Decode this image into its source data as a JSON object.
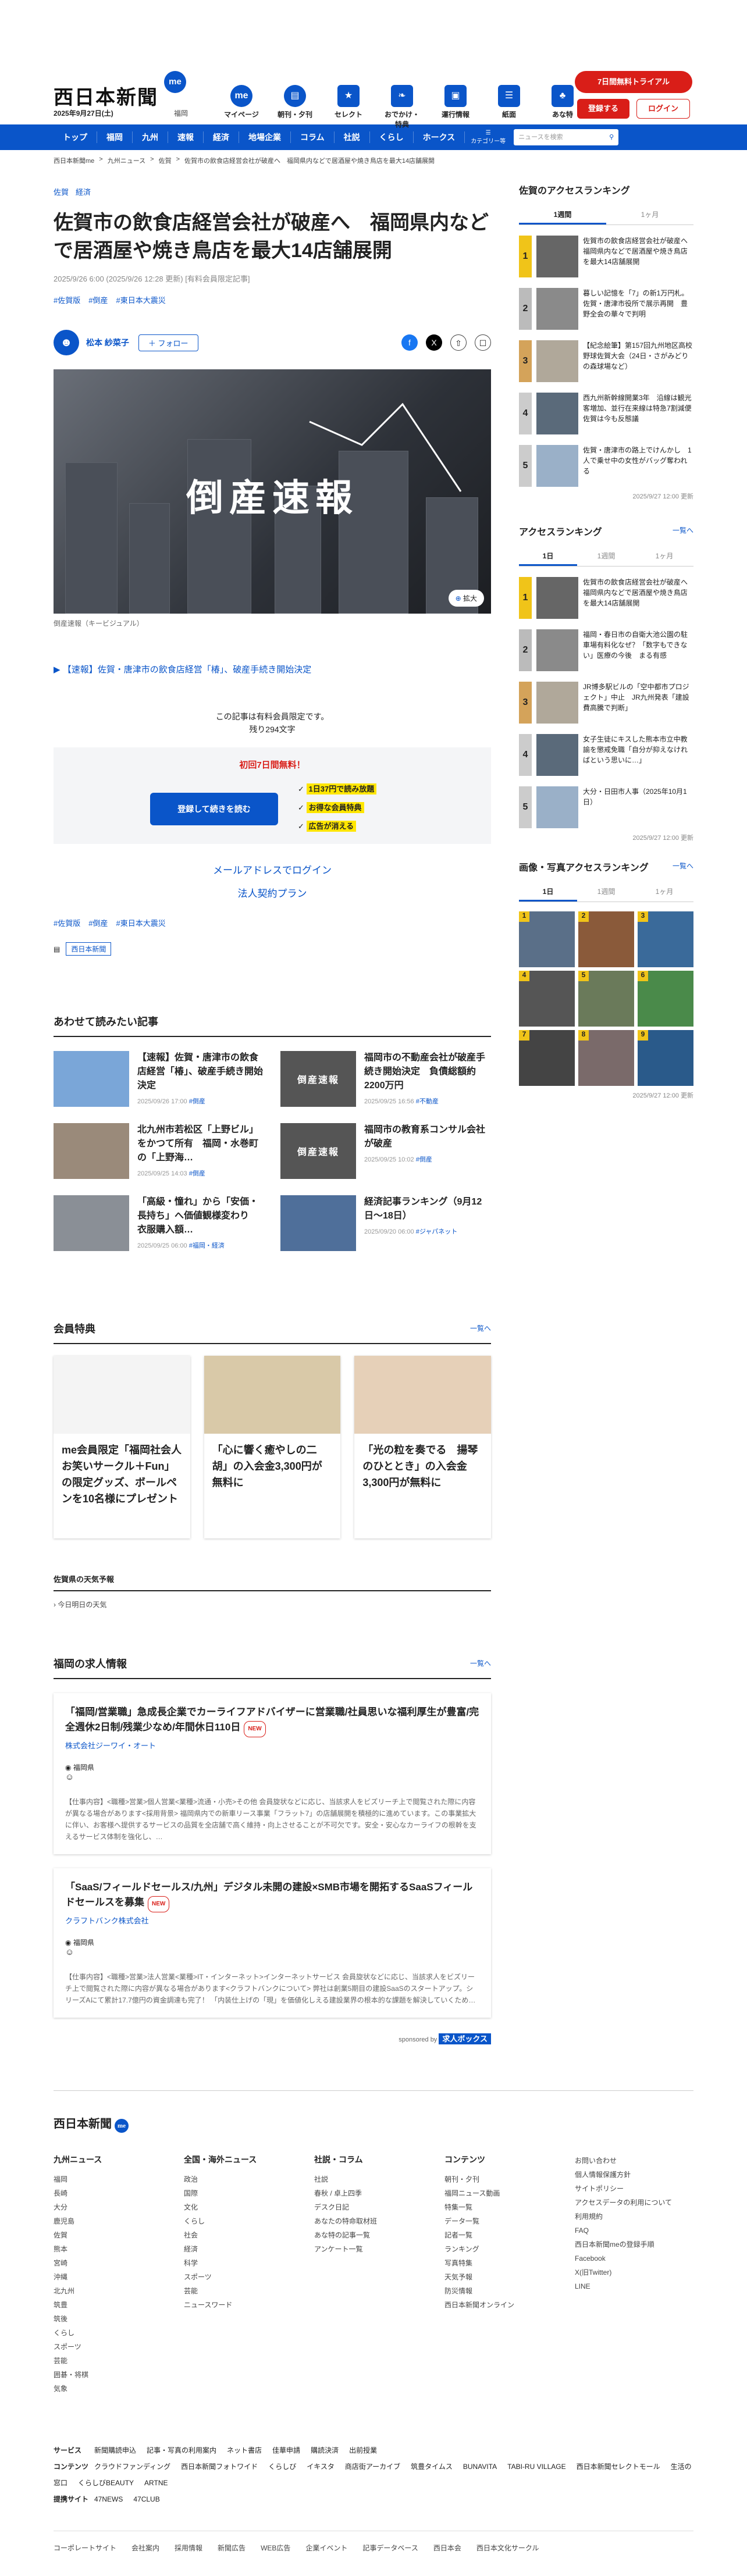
{
  "header": {
    "logo": "西日本新聞",
    "badge": "me",
    "date": "2025年9月27日(土)",
    "area": "福岡",
    "icons": [
      {
        "label": "マイページ",
        "icon": "me-icon"
      },
      {
        "label": "朝刊・夕刊",
        "icon": "newspaper-icon"
      },
      {
        "label": "セレクト",
        "icon": "select-icon"
      },
      {
        "label": "おでかけ・特典",
        "icon": "footprint-icon"
      },
      {
        "label": "運行情報",
        "icon": "train-icon"
      },
      {
        "label": "紙面",
        "icon": "paper-icon"
      },
      {
        "label": "あな特",
        "icon": "cat-icon"
      }
    ],
    "trial": "7日間無料トライアル",
    "register": "登録する",
    "login": "ログイン"
  },
  "nav": {
    "items": [
      "トップ",
      "福岡",
      "九州",
      "速報",
      "経済",
      "地場企業",
      "コラム",
      "社説",
      "くらし",
      "ホークス"
    ],
    "menu": "カテゴリー等",
    "search_placeholder": "ニュースを検索"
  },
  "breadcrumb": [
    "西日本新聞me",
    "九州ニュース",
    "佐賀",
    "佐賀市の飲食店経営会社が破産へ　福岡県内などで居酒屋や焼き鳥店を最大14店舗展開"
  ],
  "article": {
    "cats": [
      "佐賀",
      "経済"
    ],
    "title": "佐賀市の飲食店経営会社が破産へ　福岡県内などで居酒屋や焼き鳥店を最大14店舗展開",
    "meta": "2025/9/26 6:00 (2025/9/26 12:28 更新)  [有料会員限定記事]",
    "tags": [
      "#佐賀版",
      "#倒産",
      "#東日本大震災"
    ],
    "author": "松本 紗菜子",
    "follow": "＋ フォロー",
    "hero_text": "倒産速報",
    "zoom": "拡大",
    "caption": "倒産速報（キービジュアル）",
    "related": "【速報】佐賀・唐津市の飲食店経営「椿」、破産手続き開始決定",
    "paywall_note": "この記事は有料会員限定です。",
    "paywall_remaining": "残り294文字",
    "offer": "初回7日間無料！",
    "read_button": "登録して続きを読む",
    "benefits": [
      "1日37円で読み放題",
      "お得な会員特典",
      "広告が消える"
    ],
    "mail_login": "メールアドレスでログイン",
    "corp_plan": "法人契約プラン",
    "tags2": [
      "#佐賀版",
      "#倒産",
      "#東日本大震災"
    ],
    "source": "西日本新聞"
  },
  "related_section": {
    "title": "あわせて読みたい記事",
    "items": [
      {
        "title": "【速報】佐賀・唐津市の飲食店経営「椿」、破産手続き開始決定",
        "date": "2025/09/26 17:00",
        "tag": "#倒産",
        "thumb": "map-thumb"
      },
      {
        "title": "福岡市の不動産会社が破産手続き開始決定　負債総額約2200万円",
        "date": "2025/09/25 16:56",
        "tag": "#不動産",
        "thumb": "倒産速報"
      },
      {
        "title": "北九州市若松区「上野ビル」をかつて所有　福岡・水巻町の「上野海…",
        "date": "2025/09/25 14:03",
        "tag": "#倒産",
        "thumb": "building-thumb"
      },
      {
        "title": "福岡市の教育系コンサル会社が破産",
        "date": "2025/09/25 10:02",
        "tag": "#倒産",
        "thumb": "倒産速報"
      },
      {
        "title": "「高級・憧れ」から「安価・長持ち」へ価値観様変わり　衣服購入額…",
        "date": "2025/09/25 06:00",
        "tag": "#福岡・経済",
        "thumb": "street-thumb"
      },
      {
        "title": "経済記事ランキング（9月12日〜18日）",
        "date": "2025/09/20 06:00",
        "tag": "#ジャパネット",
        "thumb": "city-thumb"
      }
    ]
  },
  "perks": {
    "title": "会員特典",
    "more": "一覧へ",
    "items": [
      "me会員限定「福岡社会人お笑いサークル＋Fun」の限定グッズ、ボールペンを10名様にプレゼント",
      "「心に響く癒やしの二胡」の入会金3,300円が無料に",
      "「光の粒を奏でる　揚琴のひととき」の入会金3,300円が無料に"
    ]
  },
  "weather": {
    "title": "佐賀県の天気予報",
    "sub": "今日明日の天気"
  },
  "jobs": {
    "title": "福岡の求人情報",
    "more": "一覧へ",
    "items": [
      {
        "title": "「福岡/営業職」急成長企業でカーライフアドバイザーに営業職/社員思いな福利厚生が豊富/完全週休2日制/残業少なめ/年間休日110日",
        "new": "NEW",
        "company": "株式会社ジーワイ・オート",
        "location": "福岡県",
        "desc": "【仕事内容】<職種>営業>個人営業<業種>流通・小売>その他 会員旋状などに応じ、当該求人をビズリーチ上で閲覧された際に内容が異なる場合があります<採用背景> 福岡県内での新車リース事業「フラット7」の店舗展開を積極的に進めています。この事業拡大に伴い、お客様へ提供するサービスの品質を全店舗で高く維持・向上させることが不可欠です。安全・安心なカーライフの根幹を支えるサービス体制を強化し、…"
      },
      {
        "title": "「SaaS/フィールドセールス/九州」デジタル未開の建設×SMB市場を開拓するSaaSフィールドセールスを募集",
        "new": "NEW",
        "company": "クラフトバンク株式会社",
        "location": "福岡県",
        "desc": "【仕事内容】<職種>営業>法人営業<業種>IT・インターネット>インターネットサービス 会員旋状などに応じ、当該求人をビズリーチ上で閲覧された際に内容が異なる場合があります<クラフトバンクについて> 弊社は創業5期目の建設SaaSのスタートアップ。シリーズAにて累計17.7億円の資金調達も完了！ 「内装仕上げの「現」を価値化しえる建設業界の根本的な課題を解決していくため…"
      }
    ],
    "sponsor": "sponsored by",
    "sponsor_brand": "求人ボックス"
  },
  "sidebar": {
    "ranking1": {
      "title": "佐賀のアクセスランキング",
      "tabs": [
        "1週間",
        "1ヶ月"
      ],
      "items": [
        "佐賀市の飲食店経営会社が破産へ　福岡県内などで居酒屋や焼き鳥店を最大14店舗展開",
        "暮しい記憶を「7」の新1万円札。佐賀・唐津市役所で展示再開　豊野全会の華々で判明",
        "【紀念絵筆】第157回九州地区高校野球佐賀大会（24日・さがみどりの森球場など）",
        "西九州新幹線開業3年　沿線は観光客増加、並行在来線は特急7割減便　佐賀は今も反態議",
        "佐賀・唐津市の路上でけんかし　1人で乗せ中の女性がバッグ奪われる"
      ],
      "updated": "2025/9/27 12:00 更新"
    },
    "ranking2": {
      "title": "アクセスランキング",
      "more": "一覧へ",
      "tabs": [
        "1日",
        "1週間",
        "1ヶ月"
      ],
      "items": [
        "佐賀市の飲食店経営会社が破産へ　福岡県内などで居酒屋や焼き鳥店を最大14店舗展開",
        "福岡・春日市の自衛大池公園の駐車場有料化なぜ？「数字もできない」医療の今後　まる有感",
        "JR博多駅ビルの「空中都市プロジェクト」中止　JR九州発表「建設費高騰で判断」",
        "女子生徒にキスした熊本市立中教諭を懲戒免職「自分が抑えなければという思いに…」",
        "大分・日田市人事（2025年10月1日）"
      ],
      "updated": "2025/9/27 12:00 更新"
    },
    "photos": {
      "title": "画像・写真アクセスランキング",
      "more": "一覧へ",
      "tabs": [
        "1日",
        "1週間",
        "1ヶ月"
      ],
      "updated": "2025/9/27 12:00 更新"
    }
  },
  "footer": {
    "logo": "西日本新聞",
    "cols": [
      {
        "title": "九州ニュース",
        "items": [
          "福岡",
          "長崎",
          "大分",
          "鹿児島",
          "佐賀",
          "熊本",
          "宮崎",
          "沖縄",
          "北九州",
          "筑豊",
          "筑後",
          "くらし",
          "スポーツ",
          "芸能",
          "囲碁・将棋",
          "気象"
        ]
      },
      {
        "title": "全国・海外ニュース",
        "items": [
          "政治",
          "国際",
          "文化",
          "くらし",
          "社会",
          "経済",
          "科学",
          "スポーツ",
          "芸能",
          "ニュースワード"
        ]
      },
      {
        "title": "社説・コラム",
        "items": [
          "社説",
          "春秋 / 卓上四季",
          "デスク日記",
          "あなたの特命取材班",
          "あな特の記事一覧",
          "アンケート一覧"
        ]
      },
      {
        "title": "コンテンツ",
        "items": [
          "朝刊・夕刊",
          "福岡ニュース動画",
          "特集一覧",
          "データ一覧",
          "記者一覧",
          "ランキング",
          "写真特集",
          "天気予報",
          "防災情報",
          "西日本新聞オンライン"
        ]
      },
      {
        "title": "",
        "items": [
          "お問い合わせ",
          "個人情報保護方針",
          "サイトポリシー",
          "アクセスデータの利用について",
          "利用規約",
          "FAQ",
          "西日本新聞meの登録手順",
          "Facebook",
          "X(旧Twitter)",
          "LINE"
        ]
      }
    ],
    "services_label": "サービス",
    "services": [
      "新聞購読申込",
      "記事・写真の利用案内",
      "ネット書店",
      "佳華申請",
      "購読決済",
      "出前授業"
    ],
    "contents_label": "コンテンツ",
    "contents": [
      "クラウドファンディング",
      "西日本新聞フォトワイド",
      "くらしび",
      "イキスタ",
      "商店街アーカイブ",
      "筑豊タイムス",
      "BUNAVITA",
      "TABI-RU VILLAGE",
      "西日本新聞セレクトモール",
      "生活の窓口",
      "くらしびBEAUTY",
      "ARTNE"
    ],
    "partners_label": "提携サイト",
    "partners": [
      "47NEWS",
      "47CLUB"
    ],
    "bottom": [
      "コーポレートサイト",
      "会社案内",
      "採用情報",
      "新聞広告",
      "WEB広告",
      "企業イベント",
      "記事データベース",
      "西日本会",
      "西日本文化サークル"
    ]
  }
}
